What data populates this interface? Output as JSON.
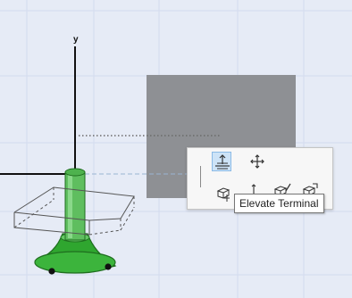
{
  "viewport": {
    "axis_label": "y",
    "background": "#e6ebf6",
    "gray_panel_color": "#8e9094",
    "selection_color": "#3cb43c"
  },
  "pet_palette": {
    "buttons": [
      {
        "name": "elevate-terminal",
        "icon": "elevate-terminal-icon",
        "active": true
      },
      {
        "name": "move",
        "icon": "move-cross-icon",
        "active": false
      },
      {
        "name": "offset-elevation",
        "icon": "offset-elevation-icon",
        "active": false
      },
      {
        "name": "move-node",
        "icon": "move-node-icon",
        "active": false
      },
      {
        "name": "stretch",
        "icon": "stretch-box-icon",
        "active": false
      },
      {
        "name": "resize",
        "icon": "resize-box-icon",
        "active": false
      }
    ]
  },
  "tooltip": {
    "text": "Elevate Terminal"
  }
}
